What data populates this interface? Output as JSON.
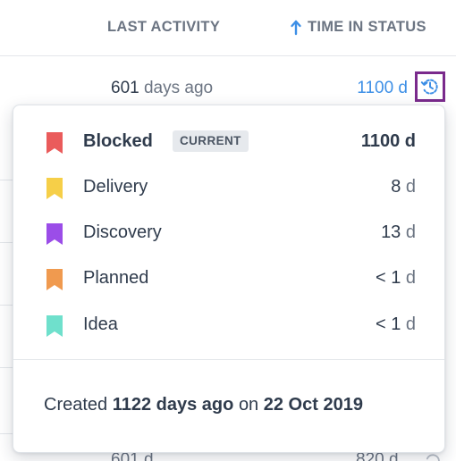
{
  "header": {
    "last_activity_label": "LAST ACTIVITY",
    "time_in_status_label": "TIME IN STATUS",
    "sort_icon": "arrow-up-icon"
  },
  "row1": {
    "last_activity_num": "601",
    "last_activity_unit": "days ago",
    "time_in_status": "1100 d",
    "history_icon": "history-clock-icon"
  },
  "bottom_row": {
    "last_activity_partial": "601 d",
    "time_partial": "820 d"
  },
  "popover": {
    "statuses": [
      {
        "name": "Blocked",
        "badge": "CURRENT",
        "value": "1100",
        "unit": "d",
        "color": "#ea5b5b",
        "current": true
      },
      {
        "name": "Delivery",
        "value": "8",
        "unit": "d",
        "color": "#f6cf48"
      },
      {
        "name": "Discovery",
        "value": "13",
        "unit": "d",
        "color": "#9b4de8"
      },
      {
        "name": "Planned",
        "value": "< 1",
        "unit": "d",
        "color": "#f09a4f"
      },
      {
        "name": "Idea",
        "value": "< 1",
        "unit": "d",
        "color": "#6fe0cc"
      }
    ],
    "created": {
      "prefix": "Created",
      "ago": "1122 days ago",
      "on": "on",
      "date": "22 Oct 2019"
    }
  },
  "colors": {
    "link_blue": "#3d8fe6",
    "focus_outline": "#7a2a8c"
  }
}
